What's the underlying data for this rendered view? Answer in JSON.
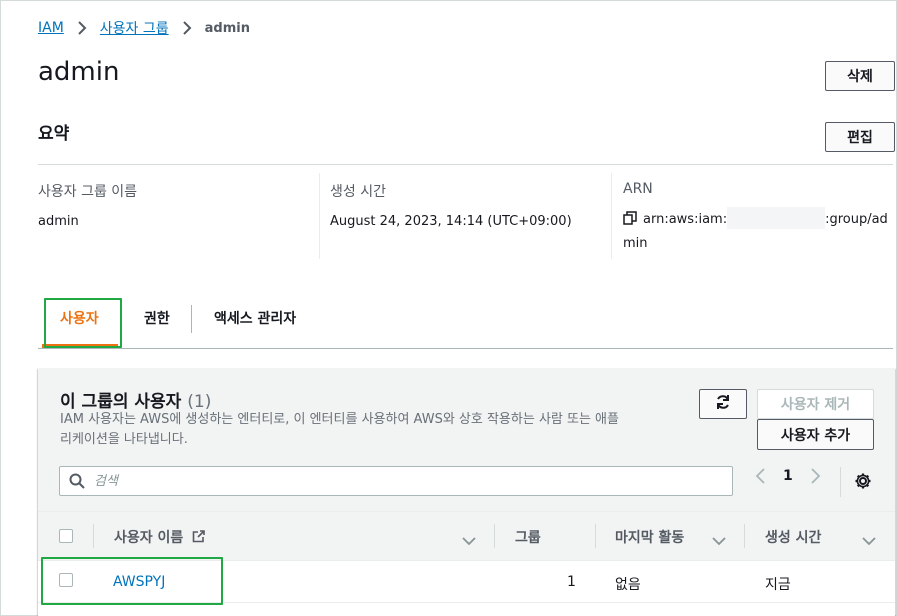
{
  "breadcrumb": {
    "root": "IAM",
    "parent": "사용자 그룹",
    "current": "admin"
  },
  "page": {
    "title": "admin",
    "delete_label": "삭제"
  },
  "summary": {
    "title": "요약",
    "edit_label": "편집",
    "name_label": "사용자 그룹 이름",
    "name_value": "admin",
    "created_label": "생성 시간",
    "created_value": "August 24, 2023, 14:14 (UTC+09:00)",
    "arn_label": "ARN",
    "arn_prefix": "arn:aws:iam:",
    "arn_suffix": ":group/ad",
    "arn_wrap": "min"
  },
  "tabs": [
    {
      "label": "사용자"
    },
    {
      "label": "권한"
    },
    {
      "label": "액세스 관리자"
    }
  ],
  "users_panel": {
    "title": "이 그룹의 사용자",
    "count": "(1)",
    "description": "IAM 사용자는 AWS에 생성하는 엔터티로, 이 엔터티를 사용하여 AWS와 상호 작용하는 사람 또는 애플리케이션을 나타냅니다.",
    "remove_label": "사용자 제거",
    "add_label": "사용자 추가",
    "search_placeholder": "검색",
    "page_number": "1",
    "columns": [
      "사용자 이름",
      "그룹",
      "마지막 활동",
      "생성 시간"
    ],
    "rows": [
      {
        "name": "AWSPYJ",
        "groups": "1",
        "last_activity": "없음",
        "created": "지금"
      }
    ]
  },
  "colors": {
    "accent": "#ec7211",
    "link": "#0073bb",
    "highlight": "#1fa843"
  },
  "icons": [
    "chevron-right-icon",
    "copy-icon",
    "refresh-icon",
    "search-icon",
    "chevron-left-icon",
    "gear-icon",
    "external-link-icon",
    "caret-down-icon"
  ]
}
